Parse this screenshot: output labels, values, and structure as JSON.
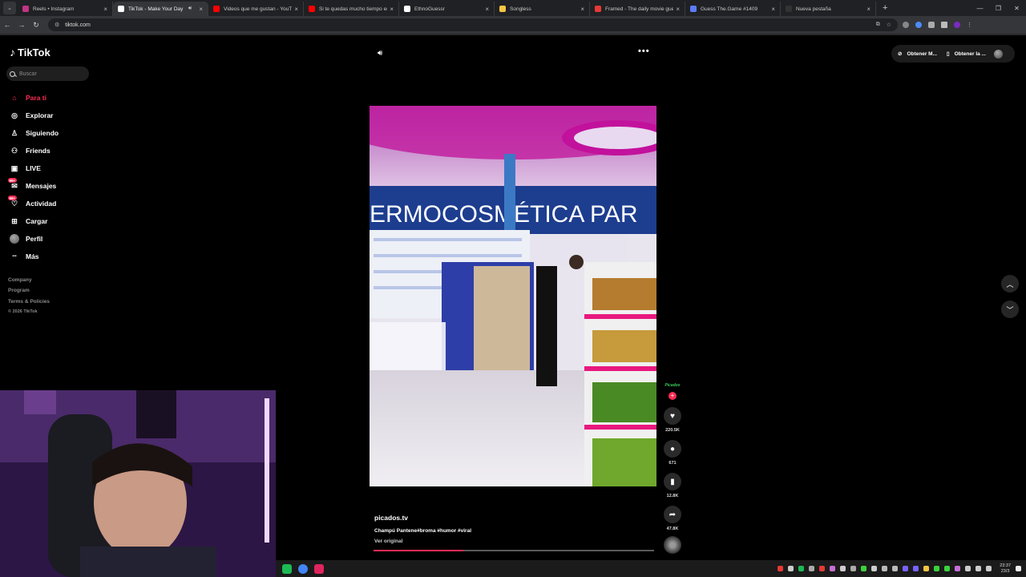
{
  "browser": {
    "tabs": [
      {
        "title": "Reels • Instagram",
        "color": "#c13584",
        "active": false
      },
      {
        "title": "TikTok - Make Your Day",
        "color": "#ffffff",
        "active": true
      },
      {
        "title": "Videos que me gustan - YouTube",
        "color": "#ff0000",
        "active": false
      },
      {
        "title": "Si te quedas mucho tiempo en...",
        "color": "#ff0000",
        "active": false
      },
      {
        "title": "EthnoGuessr",
        "color": "#ffffff",
        "active": false
      },
      {
        "title": "Songless",
        "color": "#f5c542",
        "active": false
      },
      {
        "title": "Framed - The daily movie guess",
        "color": "#e53935",
        "active": false
      },
      {
        "title": "Guess The.Game #1409",
        "color": "#5b7cfa",
        "active": false
      },
      {
        "title": "Nueva pestaña",
        "color": "#333333",
        "active": false
      }
    ],
    "url": "tiktok.com"
  },
  "sidebar": {
    "logo": "TikTok",
    "search_placeholder": "Buscar",
    "items": [
      {
        "label": "Para ti",
        "icon": "home-icon",
        "active": true
      },
      {
        "label": "Explorar",
        "icon": "compass-icon",
        "active": false
      },
      {
        "label": "Siguiendo",
        "icon": "following-icon",
        "active": false
      },
      {
        "label": "Friends",
        "icon": "friends-icon",
        "active": false
      },
      {
        "label": "LIVE",
        "icon": "live-icon",
        "active": false
      },
      {
        "label": "Mensajes",
        "icon": "messages-icon",
        "active": false,
        "badge": "99+"
      },
      {
        "label": "Actividad",
        "icon": "activity-icon",
        "active": false,
        "badge": "99+"
      },
      {
        "label": "Cargar",
        "icon": "upload-icon",
        "active": false
      },
      {
        "label": "Perfil",
        "icon": "profile-avatar",
        "active": false
      },
      {
        "label": "Más",
        "icon": "more-dots-icon",
        "active": false
      }
    ],
    "footer": [
      "Company",
      "Program",
      "Terms & Policies"
    ],
    "copyright": "© 2026 TikTok"
  },
  "topbar": {
    "get_app_label": "Obtener M...",
    "get_desktop_label": "Obtener la ..."
  },
  "video": {
    "author": "picados.tv",
    "description": "Champú Pantene#broma #humor #viral",
    "see_original": "Ver original",
    "progress": 0.32,
    "store_sign": "ERMOCOSMÉTICA PAR"
  },
  "actions": {
    "creator_label": "Picados",
    "likes": "220.5K",
    "comments": "671",
    "saves": "12.8K",
    "shares": "47.8K"
  },
  "taskbar": {
    "time": "23:37",
    "date": "23/3"
  },
  "colors": {
    "accent": "#fe2c55",
    "background": "#000000"
  }
}
